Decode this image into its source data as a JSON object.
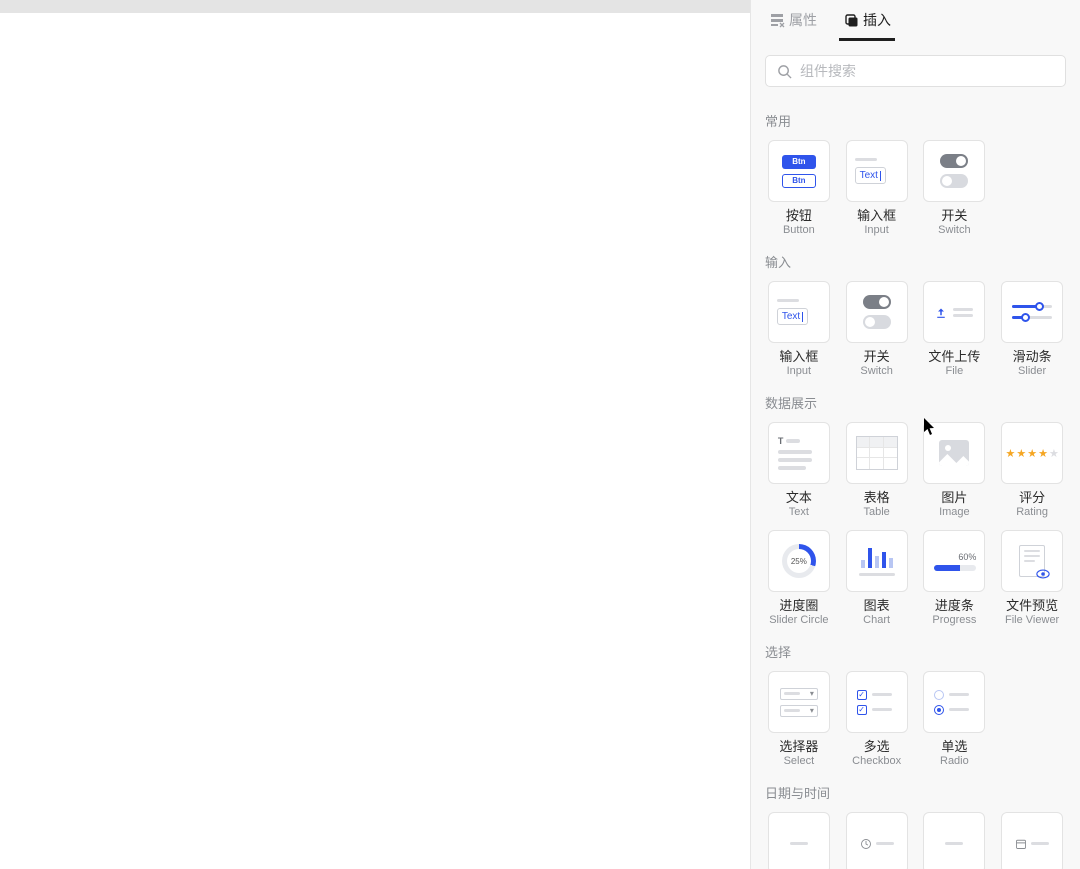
{
  "tabs": {
    "properties": "属性",
    "insert": "插入"
  },
  "search": {
    "placeholder": "组件搜索"
  },
  "sections": {
    "common": "常用",
    "input": "输入",
    "data": "数据展示",
    "select": "选择",
    "datetime": "日期与时间"
  },
  "items": {
    "button": {
      "zh": "按钮",
      "en": "Button",
      "chip": "Btn"
    },
    "input": {
      "zh": "输入框",
      "en": "Input",
      "word": "Text"
    },
    "switch": {
      "zh": "开关",
      "en": "Switch"
    },
    "file": {
      "zh": "文件上传",
      "en": "File"
    },
    "slider": {
      "zh": "滑动条",
      "en": "Slider"
    },
    "text": {
      "zh": "文本",
      "en": "Text",
      "t": "T"
    },
    "table": {
      "zh": "表格",
      "en": "Table"
    },
    "image": {
      "zh": "图片",
      "en": "Image"
    },
    "rating": {
      "zh": "评分",
      "en": "Rating"
    },
    "circle": {
      "zh": "进度圈",
      "en": "Slider Circle",
      "pct": "25%"
    },
    "chart": {
      "zh": "图表",
      "en": "Chart"
    },
    "progress": {
      "zh": "进度条",
      "en": "Progress",
      "pct": "60%"
    },
    "fileviewer": {
      "zh": "文件预览",
      "en": "File Viewer"
    },
    "select": {
      "zh": "选择器",
      "en": "Select"
    },
    "checkbox": {
      "zh": "多选",
      "en": "Checkbox"
    },
    "radio": {
      "zh": "单选",
      "en": "Radio"
    }
  }
}
